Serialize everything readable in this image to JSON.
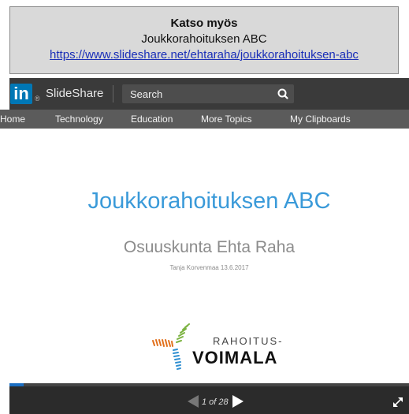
{
  "banner": {
    "title": "Katso myös",
    "subtitle": "Joukkorahoituksen ABC",
    "link": "https://www.slideshare.net/ehtaraha/joukkorahoituksen-abc"
  },
  "header": {
    "logo_text": "in",
    "registered": "®",
    "brand": "SlideShare",
    "search_placeholder": "Search"
  },
  "nav": {
    "items": [
      {
        "label": "Home"
      },
      {
        "label": "Technology"
      },
      {
        "label": "Education"
      },
      {
        "label": "More Topics"
      },
      {
        "label": "My Clipboards"
      }
    ]
  },
  "slide": {
    "title": "Joukkorahoituksen ABC",
    "subtitle": "Osuuskunta Ehta Raha",
    "author": "Tanja Korvenmaa 13.6.2017",
    "logo_line1": "RAHOITUS-",
    "logo_line2": "VOIMALA"
  },
  "player": {
    "counter": "1 of 28",
    "progress": 0.036
  },
  "colors": {
    "linkedin": "#0077b5",
    "slide_title": "#3a9ad9",
    "progress": "#1b6ec2"
  }
}
